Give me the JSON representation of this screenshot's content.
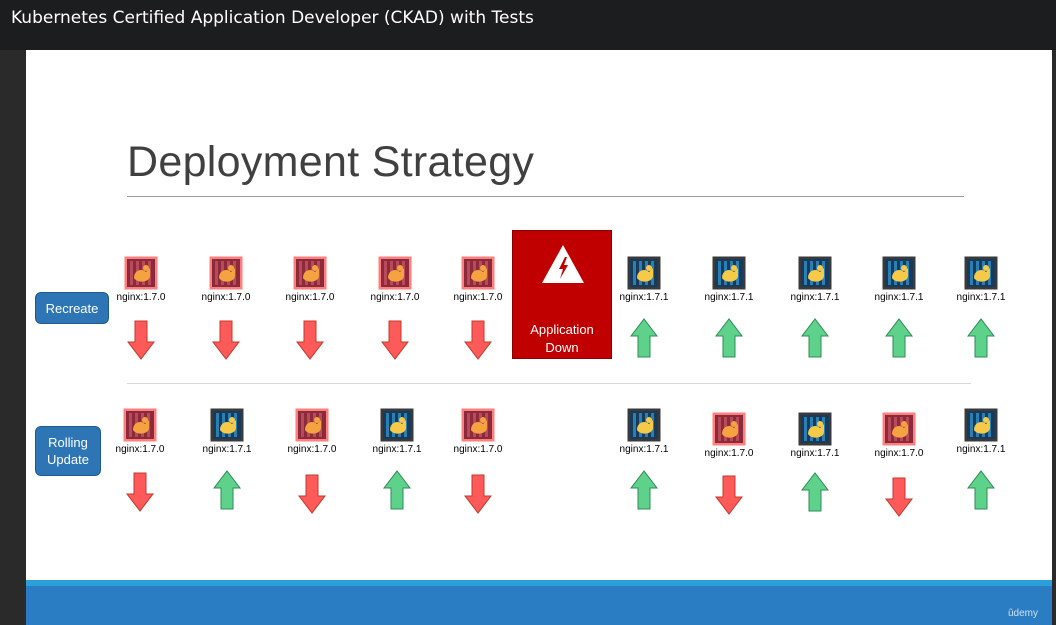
{
  "header": {
    "title": "Kubernetes Certified Application Developer (CKAD) with Tests"
  },
  "slide": {
    "title": "Deployment Strategy",
    "recreate_label": "Recreate",
    "rolling_label_line1": "Rolling",
    "rolling_label_line2": "Update",
    "app_down_line1": "Application",
    "app_down_line2": "Down",
    "watermark": "ûdemy"
  },
  "colors": {
    "old_pod": "#c0504d",
    "new_pod": "#1f4e79",
    "down_arrow": "#ff5a5a",
    "up_arrow": "#5ed28a",
    "label_bg": "#2e75b6",
    "app_down_bg": "#c00000"
  },
  "recreate": {
    "pods": [
      {
        "version": "nginx:1.7.0",
        "type": "old",
        "arrow": "down"
      },
      {
        "version": "nginx:1.7.0",
        "type": "old",
        "arrow": "down"
      },
      {
        "version": "nginx:1.7.0",
        "type": "old",
        "arrow": "down"
      },
      {
        "version": "nginx:1.7.0",
        "type": "old",
        "arrow": "down"
      },
      {
        "version": "nginx:1.7.0",
        "type": "old",
        "arrow": "down"
      },
      {
        "version": "nginx:1.7.1",
        "type": "new",
        "arrow": "up"
      },
      {
        "version": "nginx:1.7.1",
        "type": "new",
        "arrow": "up"
      },
      {
        "version": "nginx:1.7.1",
        "type": "new",
        "arrow": "up"
      },
      {
        "version": "nginx:1.7.1",
        "type": "new",
        "arrow": "up"
      },
      {
        "version": "nginx:1.7.1",
        "type": "new",
        "arrow": "up"
      }
    ]
  },
  "rolling": {
    "pods": [
      {
        "version": "nginx:1.7.0",
        "type": "old",
        "arrow": "down"
      },
      {
        "version": "nginx:1.7.1",
        "type": "new",
        "arrow": "up"
      },
      {
        "version": "nginx:1.7.0",
        "type": "old",
        "arrow": "down"
      },
      {
        "version": "nginx:1.7.1",
        "type": "new",
        "arrow": "up"
      },
      {
        "version": "nginx:1.7.0",
        "type": "old",
        "arrow": "down"
      },
      {
        "version": "nginx:1.7.1",
        "type": "new",
        "arrow": "up"
      },
      {
        "version": "nginx:1.7.0",
        "type": "old",
        "arrow": "down"
      },
      {
        "version": "nginx:1.7.1",
        "type": "new",
        "arrow": "up"
      },
      {
        "version": "nginx:1.7.0",
        "type": "old",
        "arrow": "down"
      },
      {
        "version": "nginx:1.7.1",
        "type": "new",
        "arrow": "up"
      }
    ]
  }
}
